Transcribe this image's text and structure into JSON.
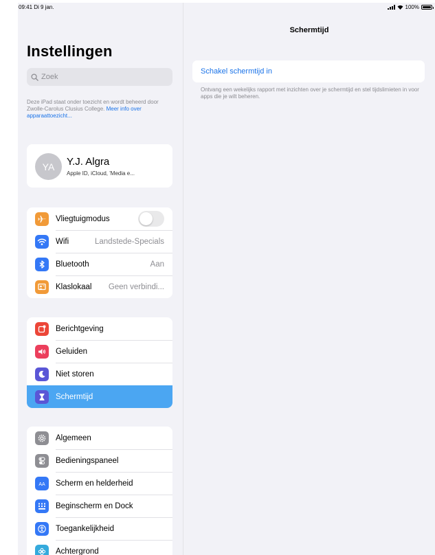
{
  "status": {
    "time": "09:41  Di 9 jan.",
    "battery": "100%"
  },
  "sidebar": {
    "title": "Instellingen",
    "search_placeholder": "Zoek",
    "supervision_text": "Deze iPad staat onder toezicht en wordt beheerd door Zwolle-Carolus Clusius College.",
    "supervision_link": "Meer info over apparaattoezicht...",
    "profile": {
      "initials": "YA",
      "name": "Y.J. Algra",
      "subtitle": "Apple ID, iCloud, 'Media e..."
    },
    "network": [
      {
        "label": "Vliegtuigmodus",
        "icon": "airplane-icon",
        "color": "#f19a38",
        "toggle": false
      },
      {
        "label": "Wifi",
        "value": "Landstede-Specials",
        "icon": "wifi-icon",
        "color": "#3478f6"
      },
      {
        "label": "Bluetooth",
        "value": "Aan",
        "icon": "bluetooth-icon",
        "color": "#3478f6"
      },
      {
        "label": "Klaslokaal",
        "value": "Geen verbindi...",
        "icon": "classroom-icon",
        "color": "#f19a38"
      }
    ],
    "notify": [
      {
        "label": "Berichtgeving",
        "icon": "notifications-icon",
        "color": "#ec4638"
      },
      {
        "label": "Geluiden",
        "icon": "sounds-icon",
        "color": "#ec3f5c"
      },
      {
        "label": "Niet storen",
        "icon": "moon-icon",
        "color": "#5a56d6"
      },
      {
        "label": "Schermtijd",
        "icon": "hourglass-icon",
        "color": "#5a56d6",
        "active": true
      }
    ],
    "general": [
      {
        "label": "Algemeen",
        "icon": "gear-icon",
        "color": "#8e8e93"
      },
      {
        "label": "Bedieningspaneel",
        "icon": "control-center-icon",
        "color": "#8e8e93"
      },
      {
        "label": "Scherm en helderheid",
        "icon": "display-icon",
        "color": "#3478f6"
      },
      {
        "label": "Beginscherm en Dock",
        "icon": "home-screen-icon",
        "color": "#3478f6"
      },
      {
        "label": "Toegankelijkheid",
        "icon": "accessibility-icon",
        "color": "#3478f6"
      },
      {
        "label": "Achtergrond",
        "icon": "wallpaper-icon",
        "color": "#35aadc"
      }
    ]
  },
  "detail": {
    "title": "Schermtijd",
    "enable_label": "Schakel schermtijd in",
    "footer": "Ontvang een wekelijks rapport met inzichten over je schermtijd en stel tijdslimieten in voor apps die je wilt beheren."
  }
}
